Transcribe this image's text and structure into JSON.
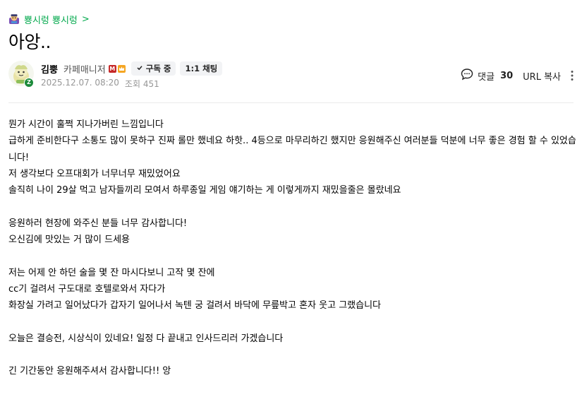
{
  "board": {
    "name": "뿅시렁 뿅시렁",
    "chevron": ">"
  },
  "post": {
    "title": "아앙..",
    "author": {
      "name": "김뿡",
      "role": "카페매니저",
      "role_badges": [
        "M",
        "crown"
      ],
      "subscribe_label": "구독 중",
      "chat_label": "1:1 채팅",
      "avatar_badge": "Z"
    },
    "date": "2025.12.07. 08:20",
    "views_label": "조회 451",
    "comment_label": "댓글",
    "comment_count": "30",
    "url_copy_label": "URL 복사",
    "content_lines": [
      "뭔가 시간이 훌쩍 지나가버린 느낌입니다",
      "급하게 준비한다구 소통도 많이 못하구 진짜 롤만 했네요 하핫.. 4등으로 마무리하긴 했지만 응원해주신 여러분들 덕분에 너무 좋은 경험 할 수 있었습",
      "니다!",
      "저 생각보다 오프대회가 너무너무 재밌었어요",
      "솔직히 나이 29살 먹고 남자들끼리 모여서 하루종일 게임 얘기하는 게 이렇게까지 재밌을줄은 몰랐네요",
      "",
      "응원하러 현장에 와주신 분들 너무 감사합니다!",
      "오신김에 맛있는 거 많이 드세용",
      "",
      "저는 어제 안 하던 술을 몇 잔 마시다보니 고작 몇 잔에",
      "cc기 걸려서 구도대로 호텔로와서 자다가",
      "화장실 가려고 일어났다가 갑자기 일어나서 녹텐 궁 걸려서 바닥에 무릎박고 혼자 웃고 그랬습니다",
      "",
      "오늘은 결승전, 시상식이 있네요! 일정 다 끝내고 인사드리러 가겠습니다",
      "",
      "긴 기간동안 응원해주셔서 감사합니다!! 앙"
    ]
  },
  "colors": {
    "accent": "#03a94d",
    "meta": "#979797",
    "chip_bg": "#f2f3f5"
  }
}
